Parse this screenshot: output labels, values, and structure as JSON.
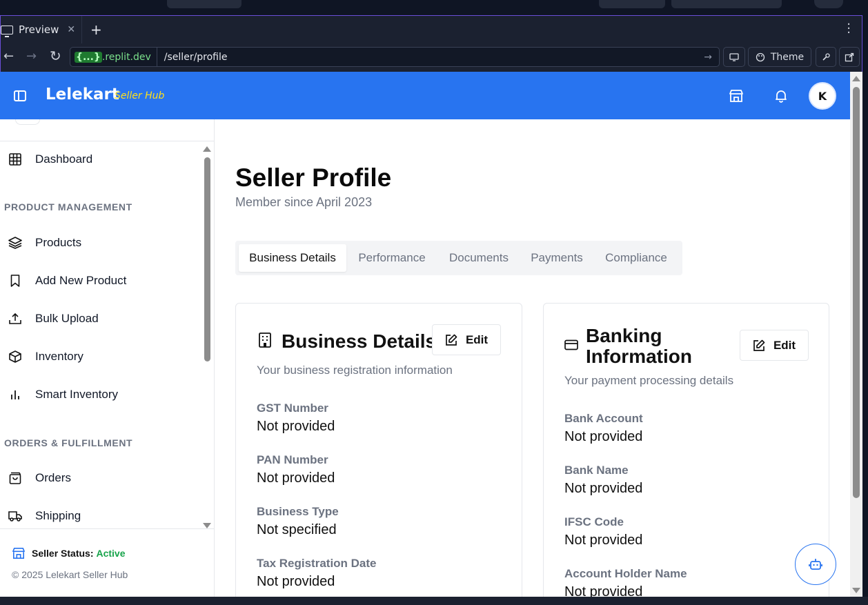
{
  "browser": {
    "tab_label": "Preview",
    "url_host_tag": "{...}",
    "url_host": ".replit.dev",
    "url_path": "/seller/profile",
    "theme_label": "Theme"
  },
  "app": {
    "brand": "Lelekart",
    "brand_sub": "Seller Hub",
    "avatar_initial": "K",
    "brand_color": "#2874f0",
    "accent_color": "#ffe11b"
  },
  "sidebar": {
    "items": [
      {
        "label": "Dashboard",
        "icon": "grid-icon"
      },
      {
        "label": "Products",
        "icon": "layers-icon"
      },
      {
        "label": "Add New Product",
        "icon": "bookmark-icon"
      },
      {
        "label": "Bulk Upload",
        "icon": "upload-icon"
      },
      {
        "label": "Inventory",
        "icon": "box-icon"
      },
      {
        "label": "Smart Inventory",
        "icon": "bar-chart-icon"
      },
      {
        "label": "Orders",
        "icon": "shopping-bag-icon"
      },
      {
        "label": "Shipping",
        "icon": "truck-icon"
      }
    ],
    "sections": [
      "PRODUCT MANAGEMENT",
      "ORDERS & FULFILLMENT"
    ],
    "status_label": "Seller Status:",
    "status_value": "Active",
    "copyright": "© 2025 Lelekart Seller Hub"
  },
  "page": {
    "title": "Seller Profile",
    "subtitle": "Member since April 2023",
    "tabs": [
      "Business Details",
      "Performance",
      "Documents",
      "Payments",
      "Compliance"
    ],
    "active_tab": "Business Details"
  },
  "business_card": {
    "title": "Business Details",
    "description": "Your business registration information",
    "edit_label": "Edit",
    "fields": [
      {
        "label": "GST Number",
        "value": "Not provided"
      },
      {
        "label": "PAN Number",
        "value": "Not provided"
      },
      {
        "label": "Business Type",
        "value": "Not specified"
      },
      {
        "label": "Tax Registration Date",
        "value": "Not provided"
      }
    ]
  },
  "banking_card": {
    "title_line1": "Banking",
    "title_line2": "Information",
    "description": "Your payment processing details",
    "edit_label": "Edit",
    "fields": [
      {
        "label": "Bank Account",
        "value": "Not provided"
      },
      {
        "label": "Bank Name",
        "value": "Not provided"
      },
      {
        "label": "IFSC Code",
        "value": "Not provided"
      },
      {
        "label": "Account Holder Name",
        "value": "Not provided"
      }
    ]
  }
}
